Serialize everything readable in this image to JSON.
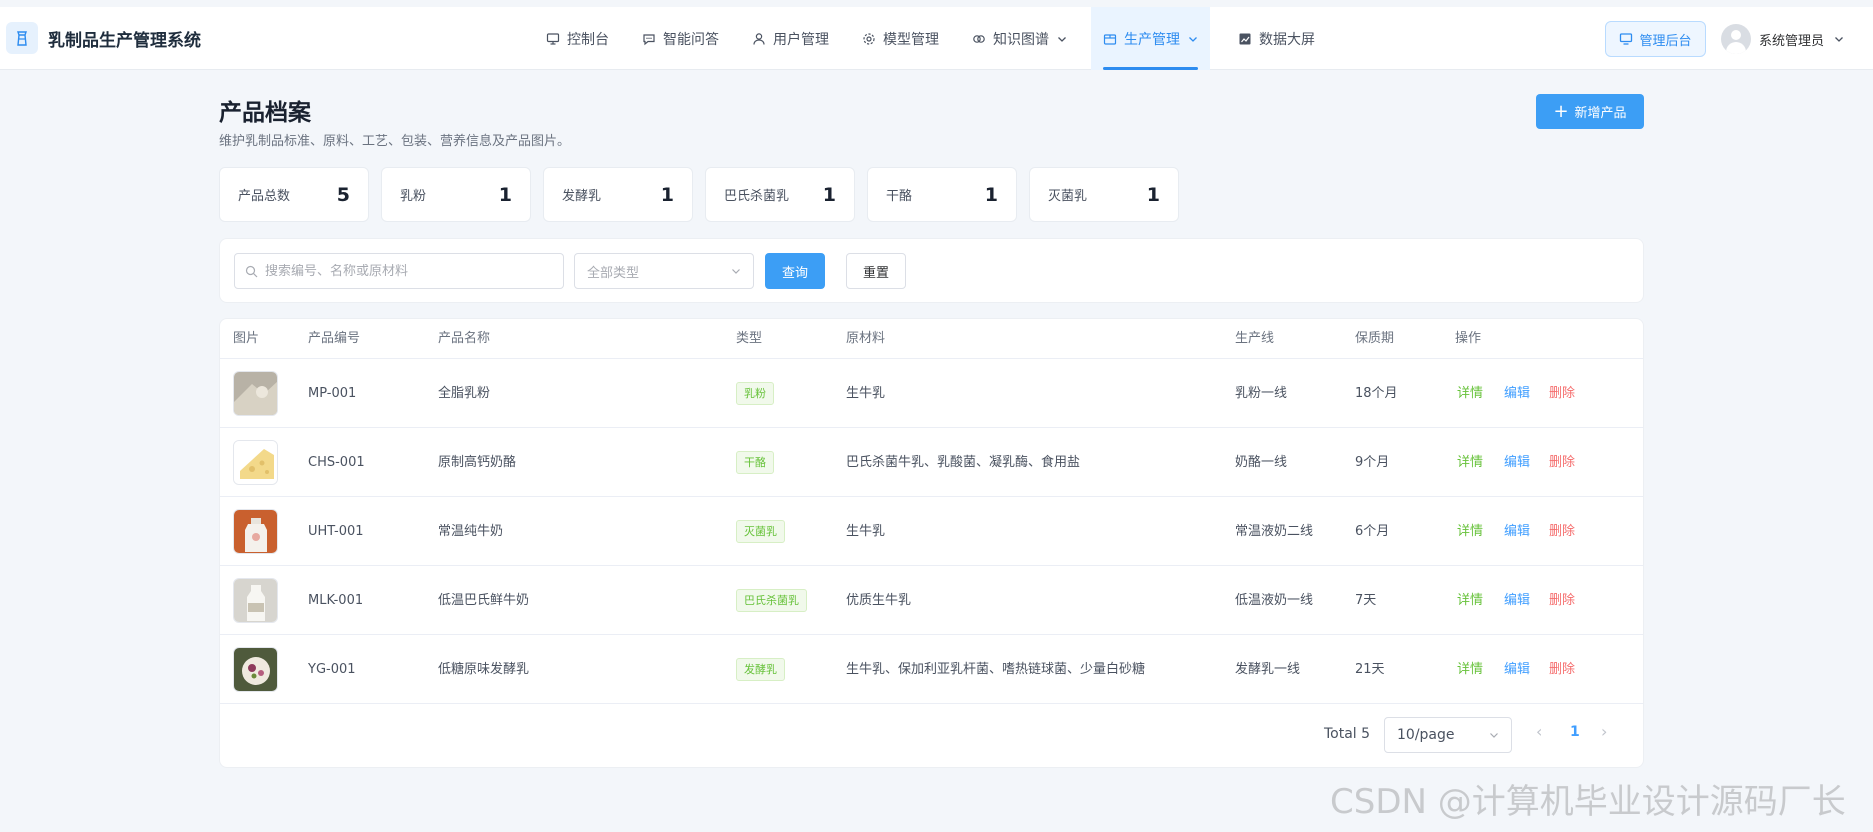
{
  "brand": {
    "title": "乳制品生产管理系统"
  },
  "nav": [
    {
      "label": "控制台",
      "icon": "monitor-icon"
    },
    {
      "label": "智能问答",
      "icon": "chat-icon"
    },
    {
      "label": "用户管理",
      "icon": "user-icon"
    },
    {
      "label": "模型管理",
      "icon": "gear-icon"
    },
    {
      "label": "知识图谱",
      "icon": "link-icon"
    },
    {
      "label": "生产管理",
      "icon": "box-icon",
      "active": true
    },
    {
      "label": "数据大屏",
      "icon": "chart-icon"
    }
  ],
  "header": {
    "admin_label": "管理后台",
    "user_name": "系统管理员"
  },
  "page": {
    "title": "产品档案",
    "subtitle": "维护乳制品标准、原料、工艺、包装、营养信息及产品图片。",
    "add_label": "新增产品"
  },
  "stats": [
    {
      "label": "产品总数",
      "value": "5"
    },
    {
      "label": "乳粉",
      "value": "1"
    },
    {
      "label": "发酵乳",
      "value": "1"
    },
    {
      "label": "巴氏杀菌乳",
      "value": "1"
    },
    {
      "label": "干酪",
      "value": "1"
    },
    {
      "label": "灭菌乳",
      "value": "1"
    }
  ],
  "filter": {
    "search_placeholder": "搜索编号、名称或原材料",
    "type_placeholder": "全部类型",
    "query_label": "查询",
    "reset_label": "重置"
  },
  "table": {
    "headers": [
      "图片",
      "产品编号",
      "产品名称",
      "类型",
      "原材料",
      "生产线",
      "保质期",
      "操作"
    ],
    "actions": {
      "detail": "详情",
      "edit": "编辑",
      "delete": "删除"
    },
    "rows": [
      {
        "code": "MP-001",
        "name": "全脂乳粉",
        "type": "乳粉",
        "material": "生牛乳",
        "line": "乳粉一线",
        "shelf": "18个月"
      },
      {
        "code": "CHS-001",
        "name": "原制高钙奶酪",
        "type": "干酪",
        "material": "巴氏杀菌牛乳、乳酸菌、凝乳酶、食用盐",
        "line": "奶酪一线",
        "shelf": "9个月"
      },
      {
        "code": "UHT-001",
        "name": "常温纯牛奶",
        "type": "灭菌乳",
        "material": "生牛乳",
        "line": "常温液奶二线",
        "shelf": "6个月"
      },
      {
        "code": "MLK-001",
        "name": "低温巴氏鲜牛奶",
        "type": "巴氏杀菌乳",
        "material": "优质生牛乳",
        "line": "低温液奶一线",
        "shelf": "7天"
      },
      {
        "code": "YG-001",
        "name": "低糖原味发酵乳",
        "type": "发酵乳",
        "material": "生牛乳、保加利亚乳杆菌、嗜热链球菌、少量白砂糖",
        "line": "发酵乳一线",
        "shelf": "21天"
      }
    ]
  },
  "pagination": {
    "total": "Total 5",
    "page_size": "10/page",
    "current": "1"
  },
  "watermark": "CSDN @计算机毕业设计源码厂长",
  "colors": {
    "primary": "#3c9ef5",
    "success": "#67c23a",
    "danger": "#f56c6c",
    "background": "#f3f6fa"
  }
}
